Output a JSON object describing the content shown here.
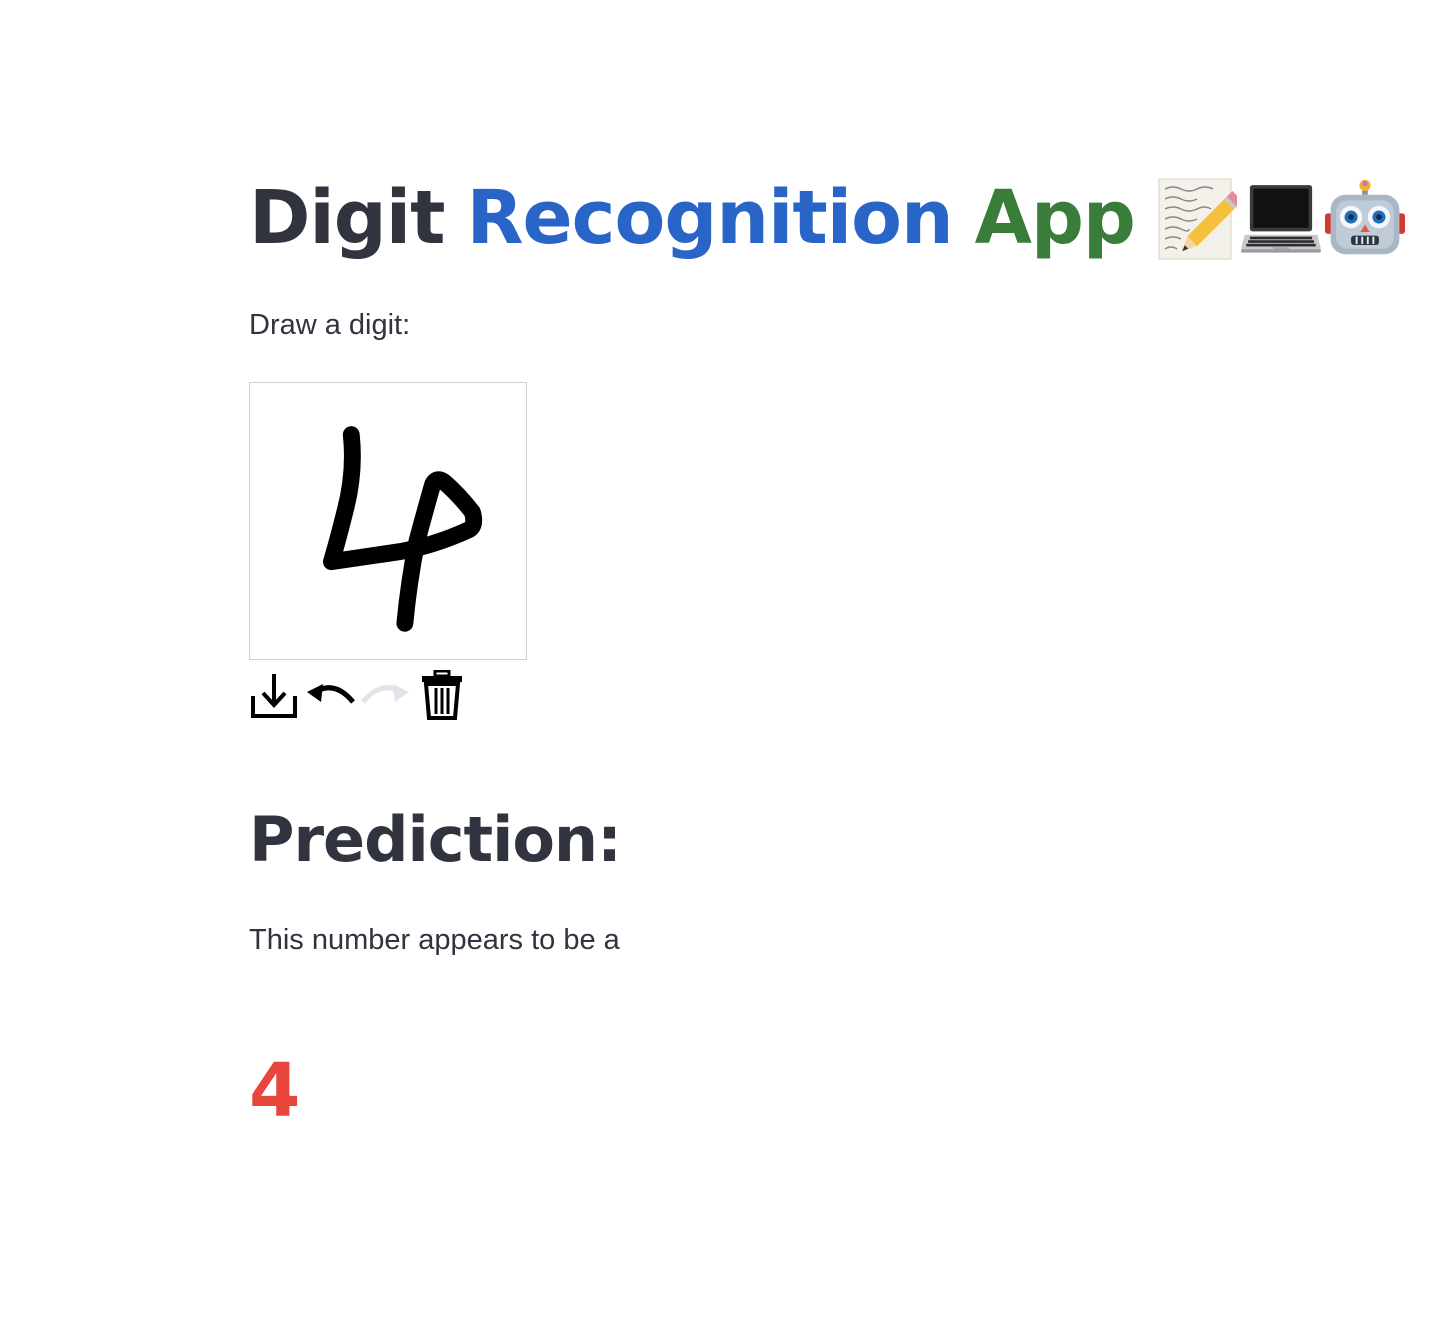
{
  "title": {
    "word1": "Digit",
    "word2": "Recognition",
    "word3": "App",
    "colors": {
      "word1": "#31333f",
      "word2": "#2965c7",
      "word3": "#3a7d3a"
    },
    "emojis": [
      "memo-icon",
      "laptop-icon",
      "robot-icon"
    ]
  },
  "draw_label": "Draw a digit:",
  "toolbar": {
    "buttons": [
      "download-icon",
      "undo-icon",
      "redo-icon",
      "trash-icon"
    ],
    "redo_enabled": false
  },
  "prediction": {
    "heading": "Prediction:",
    "text": "This number appears to be a",
    "value": "4",
    "value_color": "#e8453c"
  }
}
